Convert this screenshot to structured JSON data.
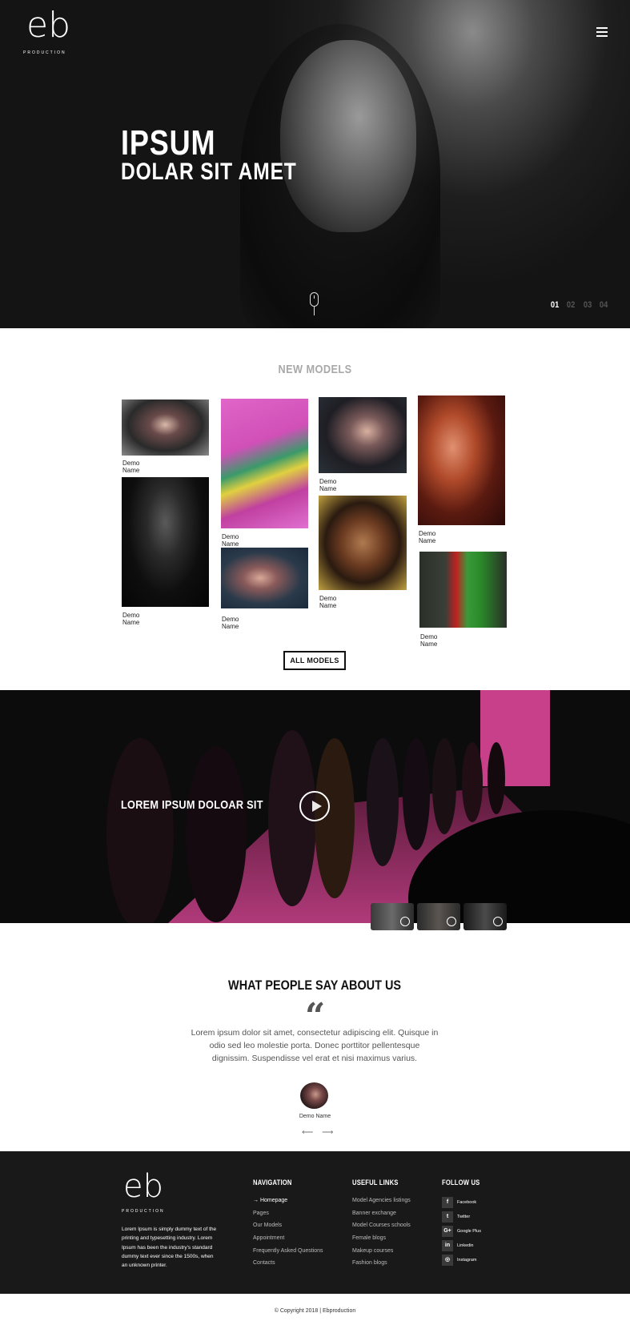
{
  "brand": {
    "logo_text": "eb",
    "logo_sub": "PRODUCTION"
  },
  "hero": {
    "title_line1": "IPSUM",
    "title_line2": "DOLAR SIT AMET",
    "slides": [
      "01",
      "02",
      "03",
      "04"
    ],
    "active_slide": "01"
  },
  "models": {
    "title": "NEW MODELS",
    "items": [
      {
        "name": "Demo Name"
      },
      {
        "name": "Demo Name"
      },
      {
        "name": "Demo Name"
      },
      {
        "name": "Demo Name"
      },
      {
        "name": "Demo Name"
      },
      {
        "name": "Demo Name"
      },
      {
        "name": "Demo Name"
      },
      {
        "name": "Demo Name"
      }
    ],
    "button_label": "ALL MODELS"
  },
  "video": {
    "title": "LOREM IPSUM DOLOAR SIT"
  },
  "testimonials": {
    "title": "WHAT PEOPLE SAY ABOUT US",
    "quote_mark": "“",
    "text": "Lorem ipsum dolor sit amet, consectetur adipiscing elit. Quisque in odio sed leo molestie porta. Donec porttitor pellentesque dignissim. Suspendisse vel erat et nisi maximus varius.",
    "author": "Demo Name",
    "arrows": "⟵ ⟶"
  },
  "footer": {
    "about": "Lorem Ipsum is simply dummy text of the printing and typesetting industry. Lorem Ipsum has been the industry's standard dummy text ever since the 1500s, when an unknown printer.",
    "nav_title": "NAVIGATION",
    "nav_items": [
      "→ Homepage",
      "Pages",
      "Our Models",
      "Appointment",
      "Frequently Asked Questions",
      "Contacts"
    ],
    "links_title": "USEFUL LINKS",
    "links_items": [
      "Model Agencies listings",
      "Banner exchange",
      "Model Courses schools",
      "Female blogs",
      "Makeup courses",
      "Fashion blogs"
    ],
    "follow_title": "FOLLOW US",
    "social": [
      {
        "icon": "f",
        "label": "Facebook"
      },
      {
        "icon": "t",
        "label": "Twitter"
      },
      {
        "icon": "G+",
        "label": "Google Plus"
      },
      {
        "icon": "in",
        "label": "Linkedin"
      },
      {
        "icon": "◎",
        "label": "Instagram"
      }
    ],
    "copyright": "© Copyright 2018 | Ebproduction"
  },
  "colors": {
    "dark": "#191919",
    "hero_bg": "#141414",
    "accent_pink": "#c0307a",
    "muted_title": "#a9a9a9"
  }
}
